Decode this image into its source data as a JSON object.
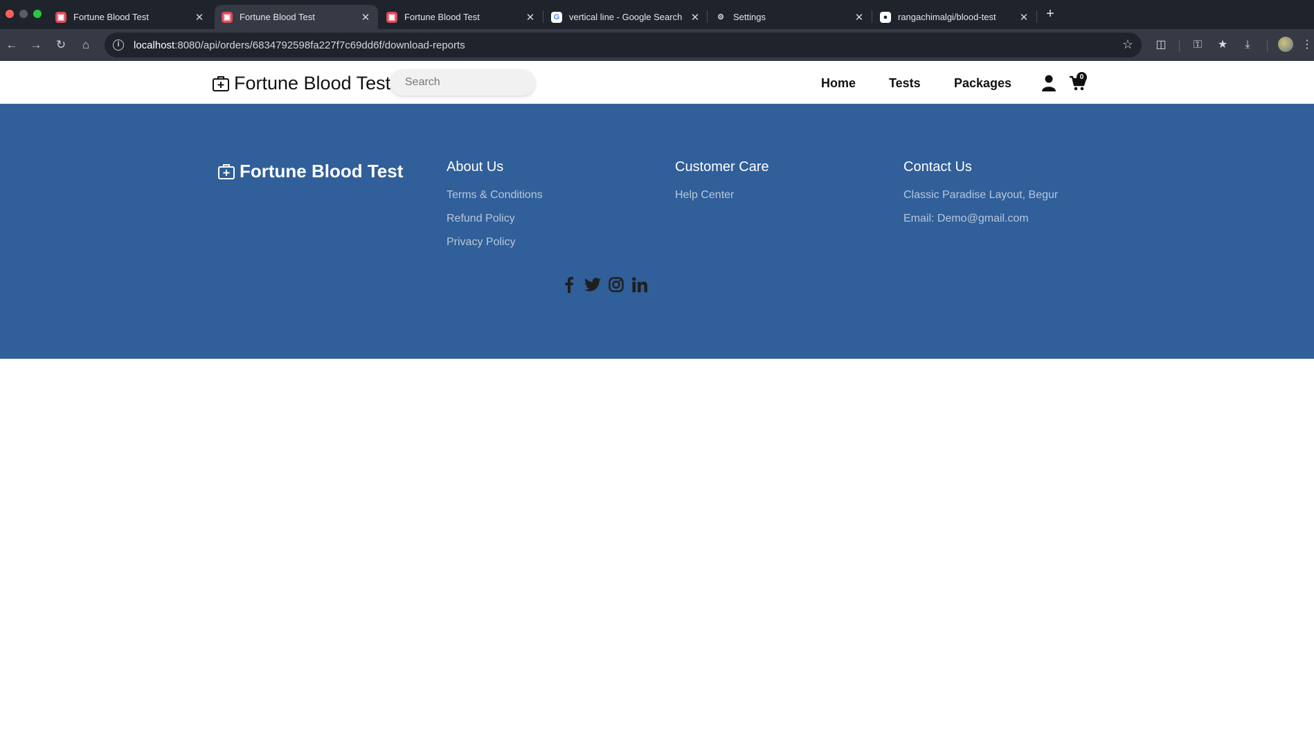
{
  "browser": {
    "tabs": [
      {
        "title": "Fortune Blood Test",
        "favicon": "blood-test-favicon",
        "active": false
      },
      {
        "title": "Fortune Blood Test",
        "favicon": "blood-test-favicon",
        "active": true
      },
      {
        "title": "Fortune Blood Test",
        "favicon": "blood-test-favicon",
        "active": false
      },
      {
        "title": "vertical line - Google Search",
        "favicon": "google-favicon",
        "active": false
      },
      {
        "title": "Settings",
        "favicon": "gear-icon",
        "active": false
      },
      {
        "title": "rangachimalgi/blood-test",
        "favicon": "github-favicon",
        "active": false
      }
    ],
    "url_host": "localhost",
    "url_path": ":8080/api/orders/6834792598fa227f7c69dd6f/download-reports"
  },
  "header": {
    "brand": "Fortune Blood Test",
    "search_placeholder": "Search",
    "nav": [
      "Home",
      "Tests",
      "Packages"
    ],
    "cart_count": "0"
  },
  "footer": {
    "brand": "Fortune Blood Test",
    "about": {
      "heading": "About Us",
      "links": [
        "Terms & Conditions",
        "Refund Policy",
        "Privacy Policy"
      ]
    },
    "care": {
      "heading": "Customer Care",
      "links": [
        "Help Center"
      ]
    },
    "contact": {
      "heading": "Contact Us",
      "lines": [
        "Classic Paradise Layout, Begur",
        "Email: Demo@gmail.com"
      ]
    },
    "social_icons": [
      "facebook-icon",
      "twitter-icon",
      "instagram-icon",
      "linkedin-icon"
    ]
  },
  "colors": {
    "footer_bg": "#305f99",
    "footer_link": "#b8c7dc",
    "chrome_bg": "#1f232b",
    "chrome_toolbar": "#353a45"
  }
}
